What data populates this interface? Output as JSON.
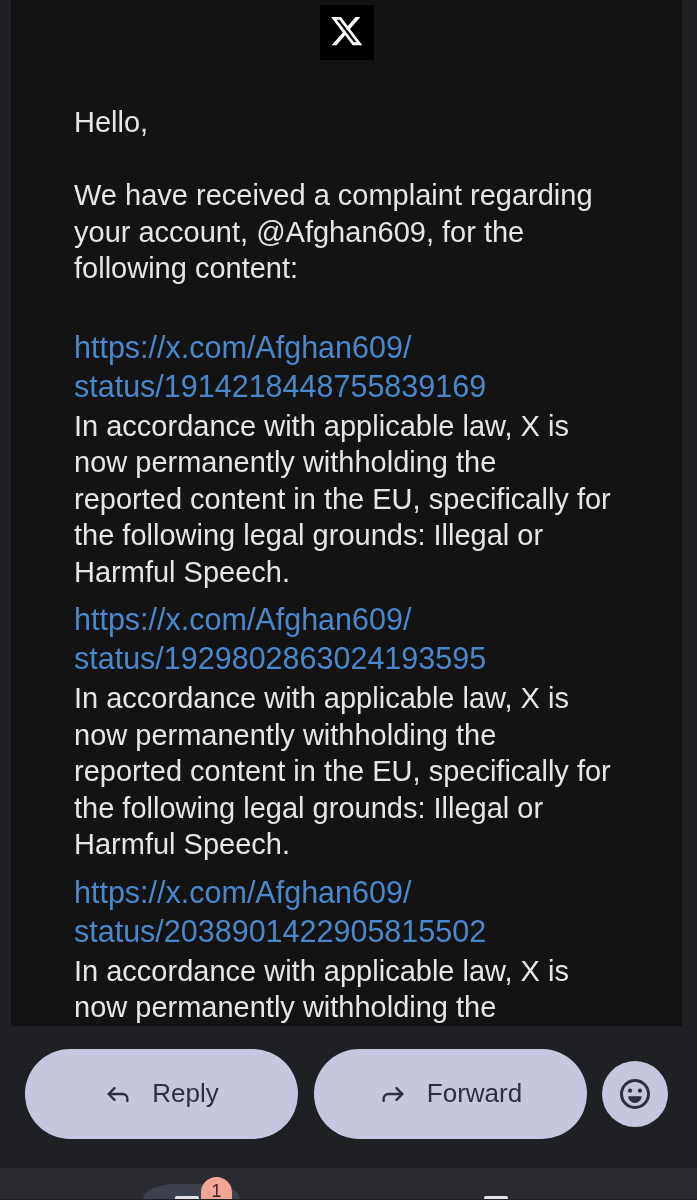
{
  "message": {
    "greeting": "Hello,",
    "intro": [
      "We have received a complaint regarding",
      "your account, @Afghan609, for the",
      "following content:"
    ],
    "items": [
      {
        "link": [
          "https://x.com/Afghan609/",
          "status/1914218448755839169"
        ],
        "notice": [
          "In accordance with applicable law, X is",
          "now permanently withholding the",
          "reported content in the EU, specifically for",
          "the following legal grounds: Illegal or",
          "Harmful Speech."
        ]
      },
      {
        "link": [
          "https://x.com/Afghan609/",
          "status/1929802863024193595"
        ],
        "notice": [
          "In accordance with applicable law, X is",
          "now permanently withholding the",
          "reported content in the EU, specifically for",
          "the following legal grounds: Illegal or",
          "Harmful Speech."
        ]
      },
      {
        "link": [
          "https://x.com/Afghan609/",
          "status/2038901422905815502"
        ],
        "notice": [
          "In accordance with applicable law, X is",
          "now permanently withholding the"
        ]
      }
    ]
  },
  "actions": [
    {
      "kind": "reply",
      "label": "Reply"
    },
    {
      "kind": "forward",
      "label": "Forward"
    },
    {
      "kind": "emoji"
    }
  ],
  "bottom_nav": [
    {
      "selected": true,
      "badge": "1"
    },
    {
      "selected": false
    }
  ]
}
